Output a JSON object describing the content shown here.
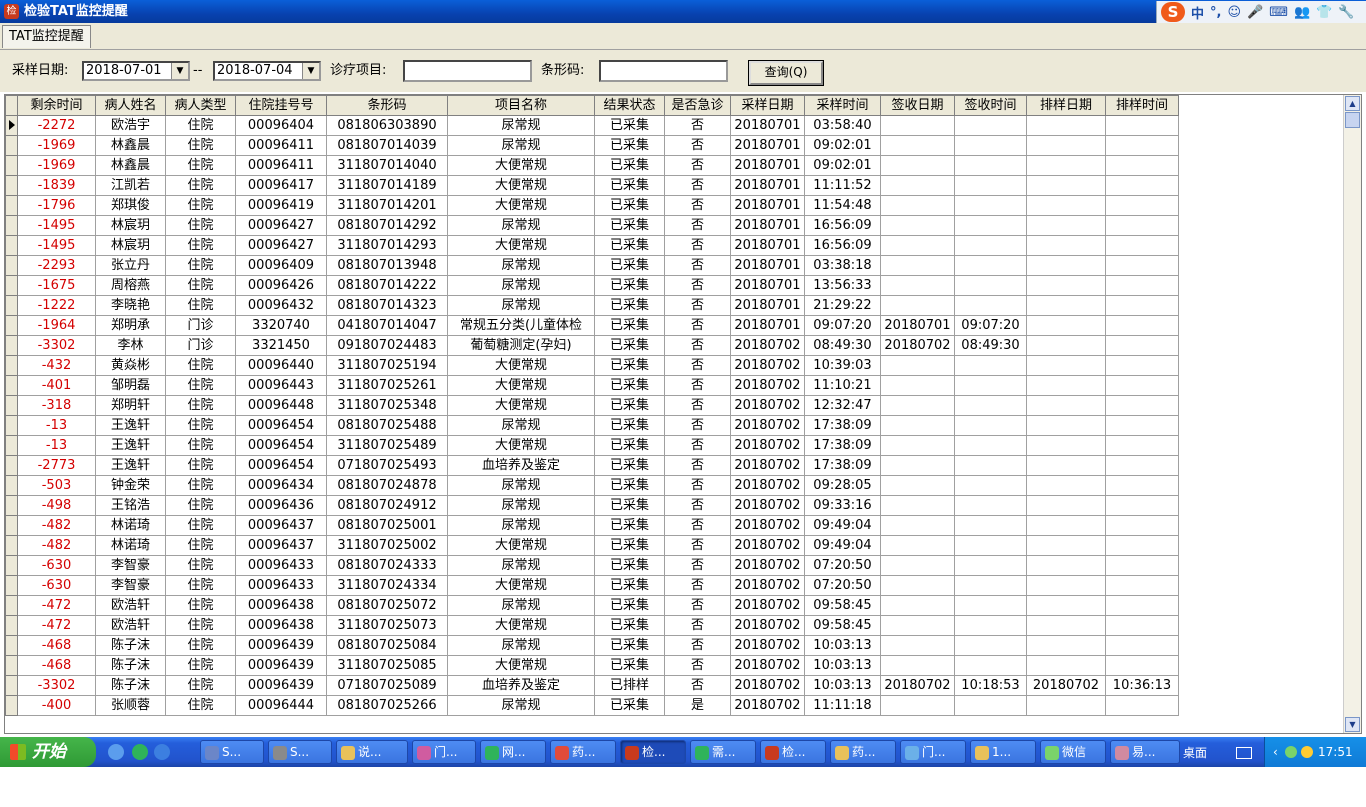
{
  "window": {
    "title": "检验TAT监控提醒"
  },
  "ime": {
    "items": [
      "中",
      "°,",
      "☺",
      "🎤",
      "⌨",
      "👥",
      "👕",
      "🔧"
    ]
  },
  "tab": {
    "label": "TAT监控提醒"
  },
  "filter": {
    "date_label": "采样日期:",
    "date_from": "2018-07-01",
    "separator": "--",
    "date_to": "2018-07-04",
    "item_label": "诊疗项目:",
    "item_value": "",
    "barcode_label": "条形码:",
    "barcode_value": "",
    "query_button": "查询(Q)"
  },
  "grid": {
    "columns": [
      "剩余时间",
      "病人姓名",
      "病人类型",
      "住院挂号号",
      "条形码",
      "项目名称",
      "结果状态",
      "是否急诊",
      "采样日期",
      "采样时间",
      "签收日期",
      "签收时间",
      "排样日期",
      "排样时间"
    ],
    "rows": [
      [
        "-2272",
        "欧浩宇",
        "住院",
        "00096404",
        "081806303890",
        "尿常规",
        "已采集",
        "否",
        "20180701",
        "03:58:40",
        "",
        "",
        "",
        ""
      ],
      [
        "-1969",
        "林鑫晨",
        "住院",
        "00096411",
        "081807014039",
        "尿常规",
        "已采集",
        "否",
        "20180701",
        "09:02:01",
        "",
        "",
        "",
        ""
      ],
      [
        "-1969",
        "林鑫晨",
        "住院",
        "00096411",
        "311807014040",
        "大便常规",
        "已采集",
        "否",
        "20180701",
        "09:02:01",
        "",
        "",
        "",
        ""
      ],
      [
        "-1839",
        "江凯若",
        "住院",
        "00096417",
        "311807014189",
        "大便常规",
        "已采集",
        "否",
        "20180701",
        "11:11:52",
        "",
        "",
        "",
        ""
      ],
      [
        "-1796",
        "郑琪俊",
        "住院",
        "00096419",
        "311807014201",
        "大便常规",
        "已采集",
        "否",
        "20180701",
        "11:54:48",
        "",
        "",
        "",
        ""
      ],
      [
        "-1495",
        "林宸玥",
        "住院",
        "00096427",
        "081807014292",
        "尿常规",
        "已采集",
        "否",
        "20180701",
        "16:56:09",
        "",
        "",
        "",
        ""
      ],
      [
        "-1495",
        "林宸玥",
        "住院",
        "00096427",
        "311807014293",
        "大便常规",
        "已采集",
        "否",
        "20180701",
        "16:56:09",
        "",
        "",
        "",
        ""
      ],
      [
        "-2293",
        "张立丹",
        "住院",
        "00096409",
        "081807013948",
        "尿常规",
        "已采集",
        "否",
        "20180701",
        "03:38:18",
        "",
        "",
        "",
        ""
      ],
      [
        "-1675",
        "周榕燕",
        "住院",
        "00096426",
        "081807014222",
        "尿常规",
        "已采集",
        "否",
        "20180701",
        "13:56:33",
        "",
        "",
        "",
        ""
      ],
      [
        "-1222",
        "李晓艳",
        "住院",
        "00096432",
        "081807014323",
        "尿常规",
        "已采集",
        "否",
        "20180701",
        "21:29:22",
        "",
        "",
        "",
        ""
      ],
      [
        "-1964",
        "郑明承",
        "门诊",
        "3320740",
        "041807014047",
        "常规五分类(儿童体检",
        "已采集",
        "否",
        "20180701",
        "09:07:20",
        "20180701",
        "09:07:20",
        "",
        ""
      ],
      [
        "-3302",
        "李林",
        "门诊",
        "3321450",
        "091807024483",
        "葡萄糖测定(孕妇)",
        "已采集",
        "否",
        "20180702",
        "08:49:30",
        "20180702",
        "08:49:30",
        "",
        ""
      ],
      [
        "-432",
        "黄焱彬",
        "住院",
        "00096440",
        "311807025194",
        "大便常规",
        "已采集",
        "否",
        "20180702",
        "10:39:03",
        "",
        "",
        "",
        ""
      ],
      [
        "-401",
        "邹明磊",
        "住院",
        "00096443",
        "311807025261",
        "大便常规",
        "已采集",
        "否",
        "20180702",
        "11:10:21",
        "",
        "",
        "",
        ""
      ],
      [
        "-318",
        "郑明轩",
        "住院",
        "00096448",
        "311807025348",
        "大便常规",
        "已采集",
        "否",
        "20180702",
        "12:32:47",
        "",
        "",
        "",
        ""
      ],
      [
        "-13",
        "王逸轩",
        "住院",
        "00096454",
        "081807025488",
        "尿常规",
        "已采集",
        "否",
        "20180702",
        "17:38:09",
        "",
        "",
        "",
        ""
      ],
      [
        "-13",
        "王逸轩",
        "住院",
        "00096454",
        "311807025489",
        "大便常规",
        "已采集",
        "否",
        "20180702",
        "17:38:09",
        "",
        "",
        "",
        ""
      ],
      [
        "-2773",
        "王逸轩",
        "住院",
        "00096454",
        "071807025493",
        "血培养及鉴定",
        "已采集",
        "否",
        "20180702",
        "17:38:09",
        "",
        "",
        "",
        ""
      ],
      [
        "-503",
        "钟金荣",
        "住院",
        "00096434",
        "081807024878",
        "尿常规",
        "已采集",
        "否",
        "20180702",
        "09:28:05",
        "",
        "",
        "",
        ""
      ],
      [
        "-498",
        "王铭浩",
        "住院",
        "00096436",
        "081807024912",
        "尿常规",
        "已采集",
        "否",
        "20180702",
        "09:33:16",
        "",
        "",
        "",
        ""
      ],
      [
        "-482",
        "林诺琦",
        "住院",
        "00096437",
        "081807025001",
        "尿常规",
        "已采集",
        "否",
        "20180702",
        "09:49:04",
        "",
        "",
        "",
        ""
      ],
      [
        "-482",
        "林诺琦",
        "住院",
        "00096437",
        "311807025002",
        "大便常规",
        "已采集",
        "否",
        "20180702",
        "09:49:04",
        "",
        "",
        "",
        ""
      ],
      [
        "-630",
        "李智豪",
        "住院",
        "00096433",
        "081807024333",
        "尿常规",
        "已采集",
        "否",
        "20180702",
        "07:20:50",
        "",
        "",
        "",
        ""
      ],
      [
        "-630",
        "李智豪",
        "住院",
        "00096433",
        "311807024334",
        "大便常规",
        "已采集",
        "否",
        "20180702",
        "07:20:50",
        "",
        "",
        "",
        ""
      ],
      [
        "-472",
        "欧浩轩",
        "住院",
        "00096438",
        "081807025072",
        "尿常规",
        "已采集",
        "否",
        "20180702",
        "09:58:45",
        "",
        "",
        "",
        ""
      ],
      [
        "-472",
        "欧浩轩",
        "住院",
        "00096438",
        "311807025073",
        "大便常规",
        "已采集",
        "否",
        "20180702",
        "09:58:45",
        "",
        "",
        "",
        ""
      ],
      [
        "-468",
        "陈子沫",
        "住院",
        "00096439",
        "081807025084",
        "尿常规",
        "已采集",
        "否",
        "20180702",
        "10:03:13",
        "",
        "",
        "",
        ""
      ],
      [
        "-468",
        "陈子沫",
        "住院",
        "00096439",
        "311807025085",
        "大便常规",
        "已采集",
        "否",
        "20180702",
        "10:03:13",
        "",
        "",
        "",
        ""
      ],
      [
        "-3302",
        "陈子沫",
        "住院",
        "00096439",
        "071807025089",
        "血培养及鉴定",
        "已排样",
        "否",
        "20180702",
        "10:03:13",
        "20180702",
        "10:18:53",
        "20180702",
        "10:36:13"
      ],
      [
        "-400",
        "张顺蓉",
        "住院",
        "00096444",
        "081807025266",
        "尿常规",
        "已采集",
        "是",
        "20180702",
        "11:11:18",
        "",
        "",
        "",
        ""
      ]
    ]
  },
  "taskbar": {
    "start_label": "开始",
    "tasks": [
      "S...",
      "S...",
      "说...",
      "门...",
      "网...",
      "药...",
      "检...",
      "需...",
      "检...",
      "药...",
      "门...",
      "1...",
      "微信",
      "易..."
    ],
    "desk_label": "桌面",
    "clock": "17:51"
  },
  "colors": {
    "accent_red": "#d40000",
    "titlebar": "#0842b0",
    "taskbar": "#245edb",
    "panel": "#ece9d8"
  }
}
